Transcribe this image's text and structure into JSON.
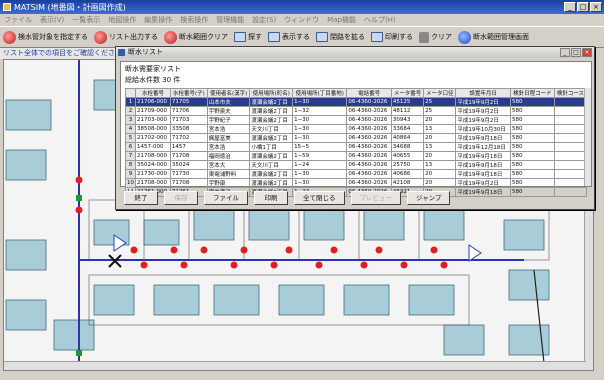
{
  "window": {
    "title": "MATSIM (地番図・計画図作成)"
  },
  "menu": [
    "ファイル",
    "表示(V)",
    "一覧表示",
    "地図操作",
    "編集操作",
    "検索操作",
    "管理機能",
    "設定(S)",
    "ウィンドウ",
    "Map機能",
    "ヘルプ(H)"
  ],
  "toolbar": [
    {
      "label": "検水管対象を指定する",
      "icon": "red"
    },
    {
      "label": "リスト出力する",
      "icon": "red"
    },
    {
      "label": "断水範囲クリア",
      "icon": "red"
    },
    {
      "label": "探す",
      "icon": "flag"
    },
    {
      "label": "表示する",
      "icon": "flag"
    },
    {
      "label": "閉路を拡る",
      "icon": "flag"
    },
    {
      "label": "印刷する",
      "icon": "flag"
    },
    {
      "label": "クリア",
      "icon": "gray"
    },
    {
      "label": "断水範囲管理画面",
      "icon": "blue"
    }
  ],
  "hint": "リスト全体での項目をご確認ください",
  "popup": {
    "title": "断水リスト",
    "heading": "断水需要家リスト",
    "count_text": "総給水件数 30 件",
    "columns": [
      "",
      "水栓番号",
      "水栓番号(子)",
      "使用者名(漢字)",
      "使用場所(町名)",
      "使用場所(丁目番地)",
      "電話番号",
      "メータ番号",
      "メータ口径",
      "設置年月日",
      "検針日程コード",
      "検針コース"
    ],
    "rows": [
      [
        "1",
        "21706-000",
        "71705",
        "山本市夫",
        "渡瀬会議2丁目",
        "1−30",
        "06-4360-2026",
        "45125",
        "25",
        "平成19年9月2日",
        "580",
        ""
      ],
      [
        "2",
        "21709-000",
        "71706",
        "宇野泉夫",
        "渡瀬会議2丁目",
        "1−32",
        "06-4360-2026",
        "48112",
        "25",
        "平成19年9月2日",
        "580",
        ""
      ],
      [
        "3",
        "21703-000",
        "71703",
        "宇野紀子",
        "渡瀬会議2丁目",
        "1−30",
        "06-4360-2026",
        "30943",
        "20",
        "平成19年9月2日",
        "580",
        ""
      ],
      [
        "4",
        "38508-000",
        "33508",
        "宮本浩",
        "天文川丁目",
        "1−30",
        "06-4360-2026",
        "33684",
        "13",
        "平成19年10月30日",
        "580",
        ""
      ],
      [
        "5",
        "21702-000",
        "71702",
        "楓屋富美",
        "渡瀬会議2丁目",
        "1−30",
        "06-4360-2026",
        "40864",
        "20",
        "平成19年9月18日",
        "580",
        ""
      ],
      [
        "6",
        "1457-000",
        "1457",
        "宮本浩",
        "小橋1丁目",
        "15−5",
        "06-4360-2026",
        "34688",
        "13",
        "平成19年12月18日",
        "580",
        ""
      ],
      [
        "7",
        "21708-000",
        "71708",
        "福岡徳治",
        "渡瀬会議2丁目",
        "1−59",
        "06-4360-2026",
        "40655",
        "20",
        "平成19年9月18日",
        "580",
        ""
      ],
      [
        "8",
        "35024-000",
        "35024",
        "宮本大",
        "天文川丁目",
        "1−24",
        "06-4360-2026",
        "25750",
        "13",
        "平成19年9月18日",
        "580",
        ""
      ],
      [
        "9",
        "21730-000",
        "71730",
        "東電浦野料",
        "渡瀬会議2丁目",
        "1−30",
        "06-4360-2026",
        "40686",
        "20",
        "平成19年9月18日",
        "580",
        ""
      ],
      [
        "10",
        "21708-000",
        "71708",
        "宇野康",
        "渡瀬会議2丁目",
        "1−30",
        "06-4360-2026",
        "42108",
        "20",
        "平成19年9月2日",
        "580",
        ""
      ],
      [
        "11",
        "21761-000",
        "71761",
        "宇井満子",
        "渡瀬会議2丁目",
        "1−22",
        "06-4360-2026",
        "46321",
        "20",
        "平成19年9月18日",
        "580",
        ""
      ]
    ],
    "selected_row": 0,
    "buttons": [
      {
        "label": "終了",
        "enabled": true
      },
      {
        "label": "保存",
        "enabled": false
      },
      {
        "label": "ファイル",
        "enabled": true
      },
      {
        "label": "印刷",
        "enabled": true
      },
      {
        "label": "全て閉じる",
        "enabled": true
      },
      {
        "label": "プレビュー",
        "enabled": false
      },
      {
        "label": "ジャンプ",
        "enabled": true
      }
    ]
  }
}
